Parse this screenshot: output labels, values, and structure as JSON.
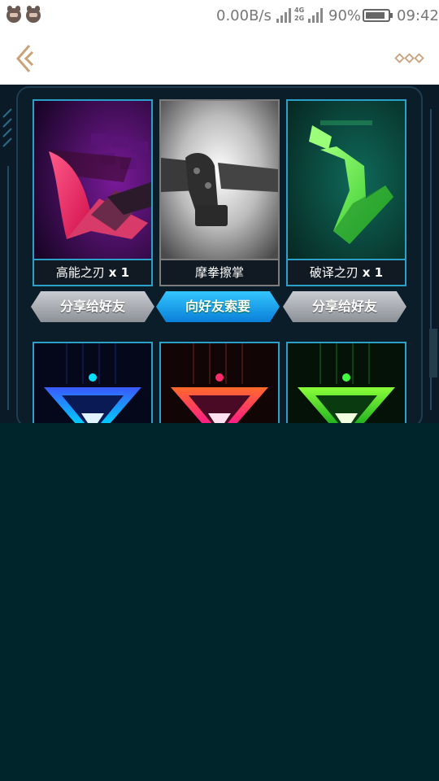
{
  "status_bar": {
    "speed": "0.00B/s",
    "network": [
      "4G",
      "2G"
    ],
    "battery_pct": "90%",
    "battery_level": 0.9,
    "time": "09:42"
  },
  "header": {
    "back_icon": "back-arrow-icon",
    "more_icon": "more-dots-icon",
    "accent": "#c9a27a"
  },
  "rewards": [
    {
      "name": "高能之刃",
      "qty": "x 1",
      "button": "分享给好友",
      "style": "silver"
    },
    {
      "name": "摩拳擦掌",
      "qty": "",
      "button": "向好友索要",
      "style": "blue"
    },
    {
      "name": "破译之刃",
      "qty": "x 1",
      "button": "分享给好友",
      "style": "silver"
    }
  ],
  "colors": {
    "card_border": "#2ba0c8",
    "button_blue": "#1ea7f0",
    "background": "#00252a"
  }
}
